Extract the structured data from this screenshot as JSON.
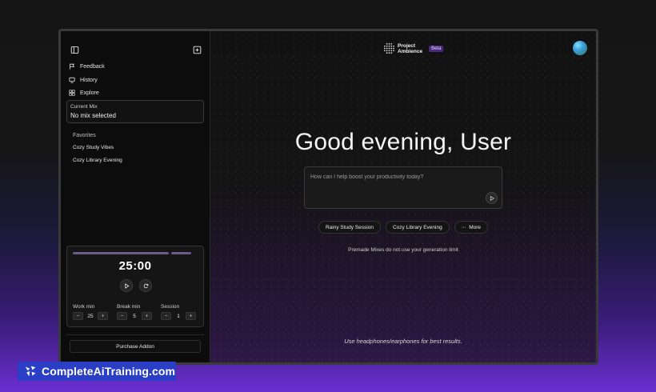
{
  "sidebar": {
    "nav": [
      {
        "label": "Feedback",
        "icon": "flag-icon"
      },
      {
        "label": "History",
        "icon": "monitor-icon"
      },
      {
        "label": "Explore",
        "icon": "grid-icon"
      }
    ],
    "current_mix": {
      "label": "Current Mix",
      "value": "No mix selected"
    },
    "favorites": {
      "heading": "Favorites",
      "items": [
        "Cozy Study Vibes",
        "Cozy Library Evening"
      ]
    },
    "timer": {
      "display": "25:00",
      "progress": [
        0.78,
        0.16
      ],
      "settings": [
        {
          "label": "Work min",
          "value": "25"
        },
        {
          "label": "Break min",
          "value": "5"
        },
        {
          "label": "Session",
          "value": "1"
        }
      ]
    },
    "purchase_label": "Purchase Addon"
  },
  "header": {
    "brand_line1": "Project",
    "brand_line2": "Ambience",
    "badge": "Beta"
  },
  "main": {
    "greeting": "Good evening, User",
    "prompt_placeholder": "How can I help boost your productivity today?",
    "chips": [
      "Rainy Study Session",
      "Cozy Library Evening",
      "More"
    ],
    "note": "Premade Mixes do not use your generation limit",
    "footer": "Use headphones/earphones for best results."
  },
  "watermark": "CompleteAiTraining.com",
  "colors": {
    "accent": "#4b2a7e",
    "badge_text": "#e4d2ff",
    "watermark_bg": "#2b3ec6"
  }
}
